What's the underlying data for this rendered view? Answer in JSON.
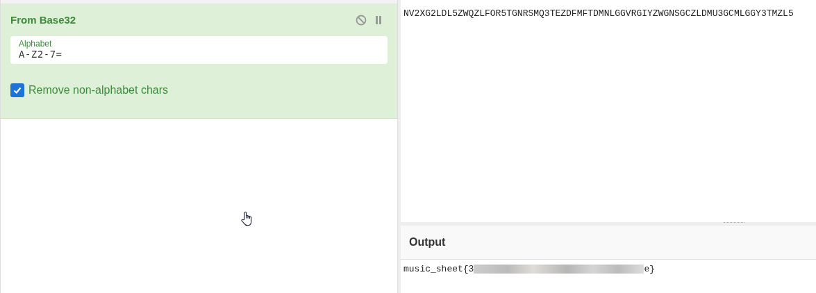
{
  "recipe": {
    "operation": {
      "title": "From Base32",
      "disabled": false,
      "paused": false,
      "alphabet": {
        "label": "Alphabet",
        "value": "A-Z2-7="
      },
      "remove_non_alphabet": {
        "label": "Remove non-alphabet chars",
        "checked": true
      }
    }
  },
  "input": {
    "text": "NV2XG2LDL5ZWQZLFOR5TGNRSMQ3TEZDFMFTDMNLGGVRGIYZWGNSGCZLDMU3GCMLGGY3TMZL5"
  },
  "output": {
    "title": "Output",
    "text_start": "music_sheet{3",
    "text_end": "e}",
    "redacted": true
  }
}
